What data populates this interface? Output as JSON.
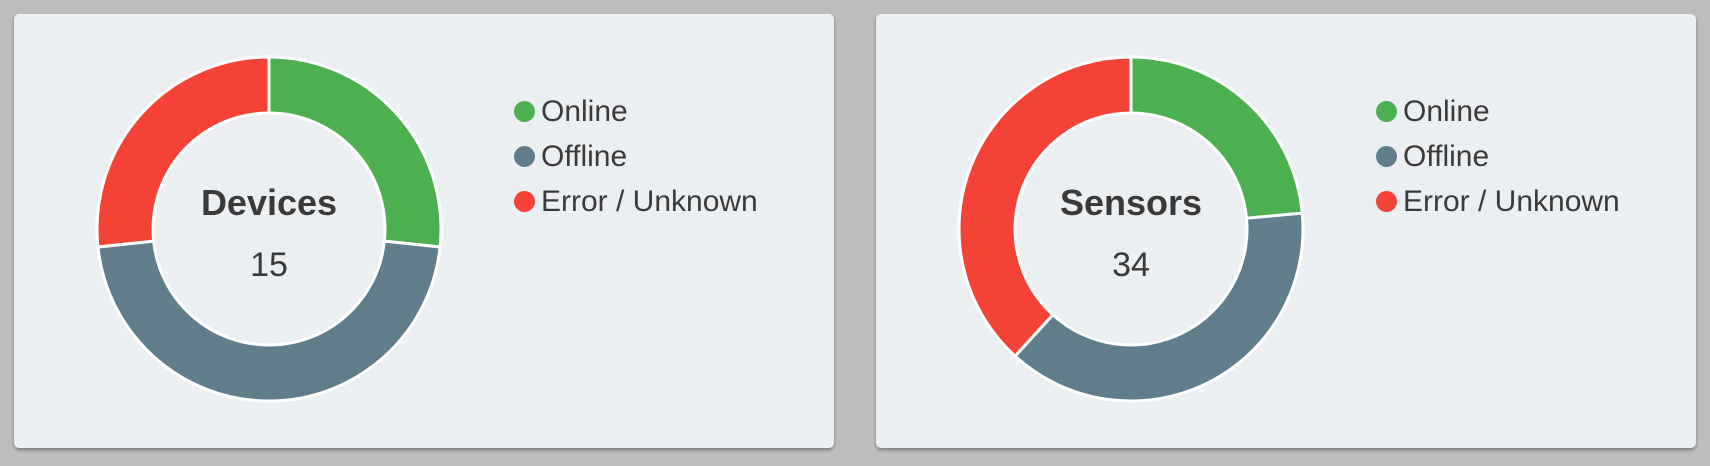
{
  "colors": {
    "online": "#4caf50",
    "offline": "#607d8b",
    "error": "#f44336"
  },
  "legend": {
    "online": "Online",
    "offline": "Offline",
    "error": "Error / Unknown"
  },
  "devices": {
    "title": "Devices",
    "count": "15"
  },
  "sensors": {
    "title": "Sensors",
    "count": "34"
  },
  "chart_data": [
    {
      "type": "pie",
      "title": "Devices",
      "categories": [
        "Online",
        "Offline",
        "Error / Unknown"
      ],
      "values": [
        4,
        7,
        4
      ],
      "colors": [
        "#4caf50",
        "#607d8b",
        "#f44336"
      ]
    },
    {
      "type": "pie",
      "title": "Sensors",
      "categories": [
        "Online",
        "Offline",
        "Error / Unknown"
      ],
      "values": [
        8,
        13,
        13
      ],
      "colors": [
        "#4caf50",
        "#607d8b",
        "#f44336"
      ]
    }
  ]
}
